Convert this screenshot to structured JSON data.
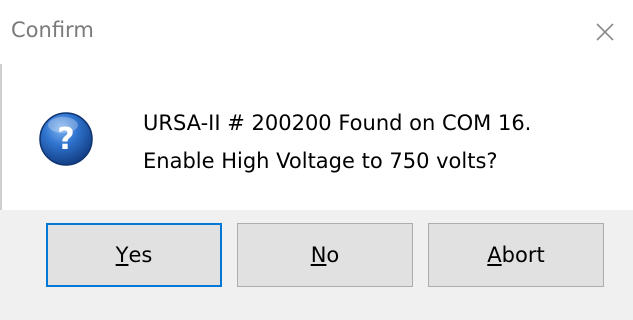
{
  "window": {
    "title": "Confirm",
    "close_glyph": "✕"
  },
  "message": {
    "line1": "URSA-II # 200200 Found on COM 16.",
    "line2": "Enable High Voltage to 750 volts?"
  },
  "icon": {
    "name": "question-icon",
    "glyph": "?",
    "color": "#1c5fb4"
  },
  "buttons": {
    "yes": {
      "mnemonic": "Y",
      "rest": "es"
    },
    "no": {
      "mnemonic": "N",
      "rest": "o"
    },
    "abort": {
      "mnemonic": "A",
      "rest": "bort"
    }
  },
  "colors": {
    "default_button_border": "#0078d7",
    "button_face": "#e1e1e1",
    "dialog_face": "#f0f0f0"
  }
}
